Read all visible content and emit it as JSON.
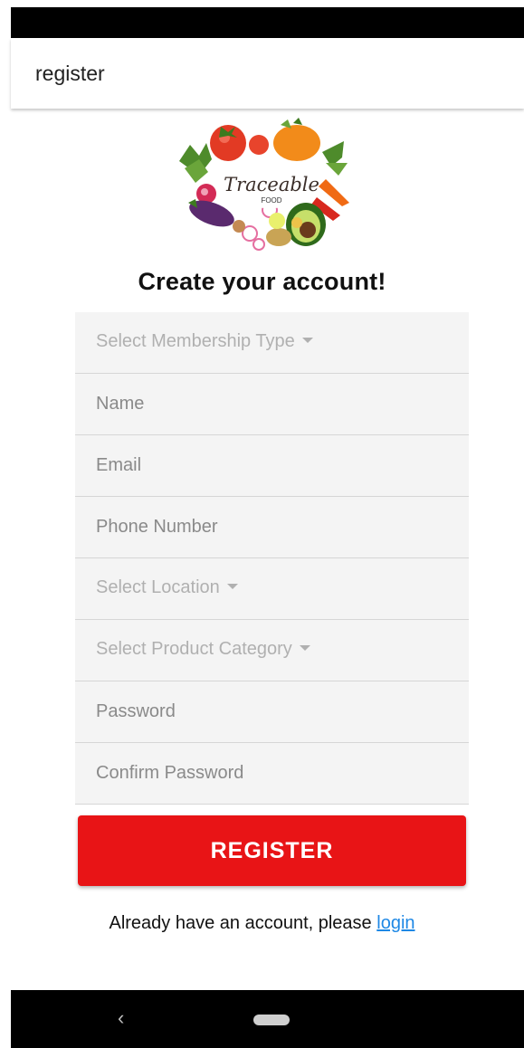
{
  "appbar": {
    "title": "register"
  },
  "logo": {
    "script_text": "Traceable",
    "sub_text": "FOOD"
  },
  "heading": "Create your account!",
  "form": {
    "membership": {
      "label": "Select Membership Type"
    },
    "name": {
      "placeholder": "Name"
    },
    "email": {
      "placeholder": "Email"
    },
    "phone": {
      "placeholder": "Phone Number"
    },
    "location": {
      "label": "Select Location"
    },
    "category": {
      "label": "Select Product Category"
    },
    "password": {
      "placeholder": "Password"
    },
    "confirm": {
      "placeholder": "Confirm Password"
    }
  },
  "register_button": "REGISTER",
  "footer": {
    "prefix": "Already have an account, please ",
    "link": "login"
  },
  "navbar": {
    "back_glyph": "‹"
  },
  "colors": {
    "accent_red": "#e81416",
    "link_blue": "#1e88e5",
    "field_bg": "#f4f4f4"
  },
  "icons": [
    "dropdown-caret-icon",
    "back-nav-icon",
    "home-pill-icon",
    "vegetable-logo"
  ]
}
